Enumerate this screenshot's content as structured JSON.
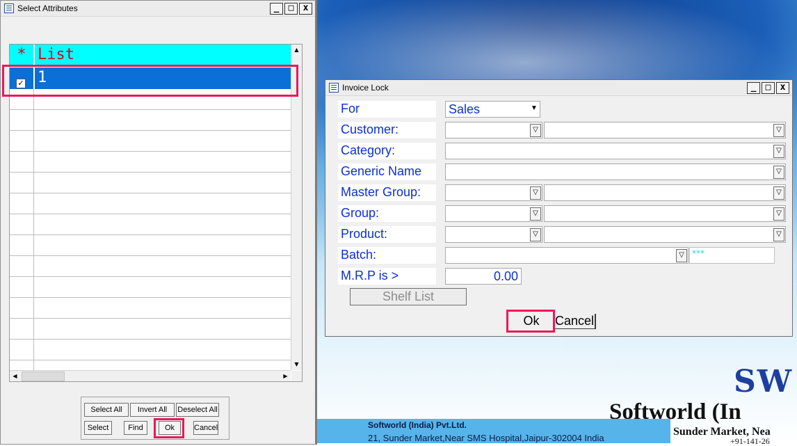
{
  "select_window": {
    "title": "Select Attributes",
    "grid": {
      "header_marker": "*",
      "header_label": "List",
      "rows": [
        {
          "checked": true,
          "value": "1"
        }
      ]
    },
    "buttons": {
      "select_all": "Select All",
      "invert_all": "Invert All",
      "deselect_all": "Deselect All",
      "select": "Select",
      "find": "Find",
      "ok": "Ok",
      "cancel": "Cancel"
    }
  },
  "invoice_window": {
    "title": "Invoice Lock",
    "fields": {
      "for_label": "For",
      "for_value": "Sales",
      "customer_label": "Customer:",
      "category_label": "Category:",
      "generic_label": "Generic Name",
      "master_group_label": "Master Group:",
      "group_label": "Group:",
      "product_label": "Product:",
      "batch_label": "Batch:",
      "batch_extra": "***",
      "mrp_label": "M.R.P is >",
      "mrp_value": "0.00"
    },
    "buttons": {
      "shelf_list": "Shelf List",
      "ok": "Ok",
      "cancel": "Cancel"
    }
  },
  "window_controls": {
    "minimize": "_",
    "maximize": "□",
    "close": "x"
  },
  "statusbar": {
    "company": "Softworld (India) Pvt.Ltd.",
    "address": "21, Sunder Market,Near SMS Hospital,Jaipur-302004 India"
  },
  "branding": {
    "logo": "SW",
    "company_name": "Softworld (In",
    "address_line": "Sunder Market, Nea",
    "phone_tail": "+91-141-26"
  },
  "colors": {
    "grid_header_bg": "#00ffff",
    "grid_header_text": "#e0001b",
    "selected_row": "#0a6fd6",
    "highlight": "#e8195b",
    "field_text": "#0b2fd6"
  }
}
